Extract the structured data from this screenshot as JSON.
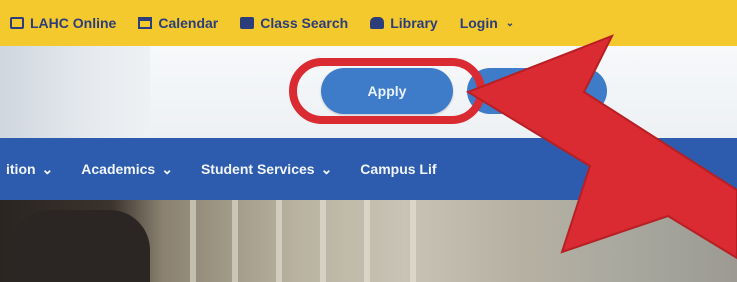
{
  "topbar": {
    "links": [
      {
        "label": "LAHC Online",
        "icon": "monitor-icon"
      },
      {
        "label": "Calendar",
        "icon": "calendar-icon"
      },
      {
        "label": "Class Search",
        "icon": "class-search-icon"
      },
      {
        "label": "Library",
        "icon": "library-icon"
      },
      {
        "label": "Login",
        "icon": "chevron-down-icon"
      }
    ]
  },
  "header": {
    "apply_label": "Apply"
  },
  "navbar": {
    "items": [
      {
        "label": "ition"
      },
      {
        "label": "Academics"
      },
      {
        "label": "Student Services"
      },
      {
        "label": "Campus Lif"
      }
    ],
    "chevron": "⌄"
  },
  "colors": {
    "topbar_bg": "#f3c92e",
    "nav_bg": "#2d5cae",
    "button_bg": "#3e7bc8",
    "annotation_red": "#d92b31"
  }
}
